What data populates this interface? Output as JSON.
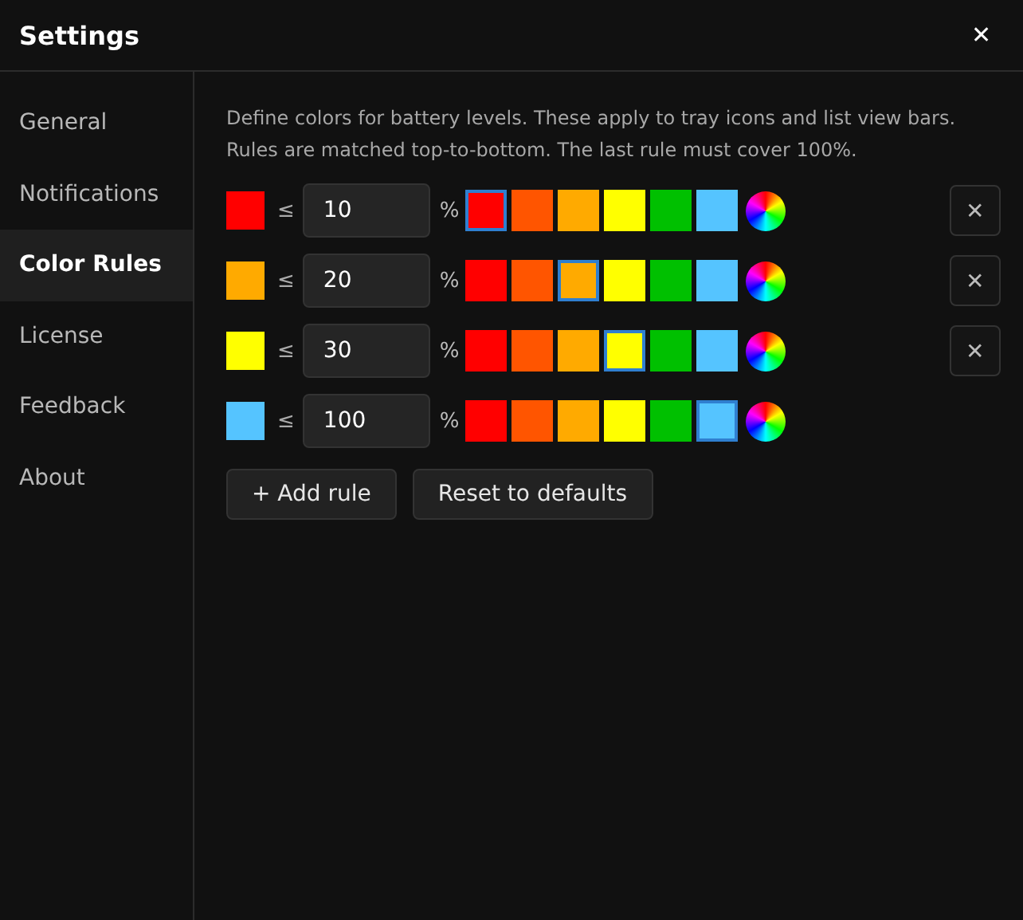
{
  "window": {
    "title": "Settings",
    "close": "✕"
  },
  "sidebar": {
    "items": [
      {
        "label": "General",
        "selected": false
      },
      {
        "label": "Notifications",
        "selected": false
      },
      {
        "label": "Color Rules",
        "selected": true
      },
      {
        "label": "License",
        "selected": false
      },
      {
        "label": "Feedback",
        "selected": false
      },
      {
        "label": "About",
        "selected": false
      }
    ]
  },
  "description": "Define colors for battery levels. These apply to tray icons and list view bars. Rules are matched top-to-bottom. The last rule must cover 100%.",
  "rules": [
    {
      "color": "#ff0000",
      "operator": "≤",
      "value": "10",
      "unit": "%",
      "remove": "✕",
      "palette": [
        {
          "color": "#ff0000",
          "selected": true
        },
        {
          "color": "#ff5500",
          "selected": false
        },
        {
          "color": "#ffaa00",
          "selected": false
        },
        {
          "color": "#ffff00",
          "selected": false
        },
        {
          "color": "#00c000",
          "selected": false
        },
        {
          "color": "#55c4ff",
          "selected": false
        }
      ]
    },
    {
      "color": "#ffaa00",
      "operator": "≤",
      "value": "20",
      "unit": "%",
      "remove": "✕",
      "palette": [
        {
          "color": "#ff0000",
          "selected": false
        },
        {
          "color": "#ff5500",
          "selected": false
        },
        {
          "color": "#ffaa00",
          "selected": true
        },
        {
          "color": "#ffff00",
          "selected": false
        },
        {
          "color": "#00c000",
          "selected": false
        },
        {
          "color": "#55c4ff",
          "selected": false
        }
      ]
    },
    {
      "color": "#ffff00",
      "operator": "≤",
      "value": "30",
      "unit": "%",
      "remove": "✕",
      "palette": [
        {
          "color": "#ff0000",
          "selected": false
        },
        {
          "color": "#ff5500",
          "selected": false
        },
        {
          "color": "#ffaa00",
          "selected": false
        },
        {
          "color": "#ffff00",
          "selected": true
        },
        {
          "color": "#00c000",
          "selected": false
        },
        {
          "color": "#55c4ff",
          "selected": false
        }
      ]
    },
    {
      "color": "#55c4ff",
      "operator": "≤",
      "value": "100",
      "unit": "%",
      "palette": [
        {
          "color": "#ff0000",
          "selected": false
        },
        {
          "color": "#ff5500",
          "selected": false
        },
        {
          "color": "#ffaa00",
          "selected": false
        },
        {
          "color": "#ffff00",
          "selected": false
        },
        {
          "color": "#00c000",
          "selected": false
        },
        {
          "color": "#55c4ff",
          "selected": true
        }
      ]
    }
  ],
  "buttons": [
    "+ Add rule",
    "Reset to defaults"
  ]
}
